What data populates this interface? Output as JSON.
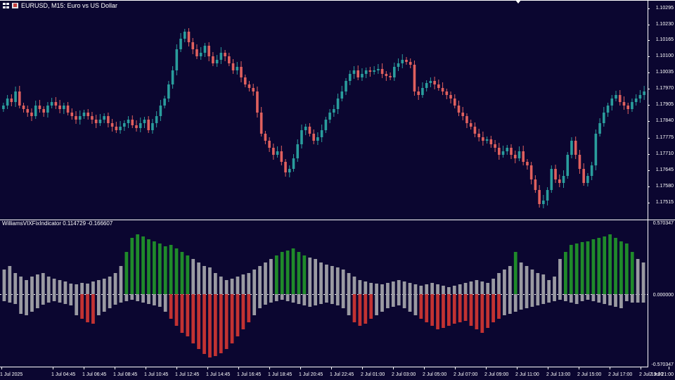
{
  "window": {
    "symbol_title": "EURUSD, M15:  Euro vs US Dollar",
    "icons": [
      "grid-icon",
      "chart-icon",
      "scroll-marker-icon"
    ]
  },
  "indicator": {
    "header": "WilliamsVIXFixIndicator 0.114729 -0.166607",
    "scale_labels": [
      "0.570347",
      "0.000000",
      "-0.570347"
    ]
  },
  "price_axis": {
    "labels": [
      "1.10295",
      "1.10230",
      "1.10165",
      "1.10100",
      "1.10035",
      "1.17970",
      "1.17905",
      "1.17840",
      "1.17775",
      "1.17710",
      "1.17645",
      "1.17580",
      "1.17515"
    ]
  },
  "time_axis": {
    "labels": [
      "1 Jul 2025",
      "1 Jul 04:45",
      "1 Jul 06:45",
      "1 Jul 08:45",
      "1 Jul 10:45",
      "1 Jul 12:45",
      "1 Jul 14:45",
      "1 Jul 16:45",
      "1 Jul 18:45",
      "1 Jul 20:45",
      "1 Jul 22:45",
      "2 Jul 01:00",
      "2 Jul 03:00",
      "2 Jul 05:00",
      "2 Jul 07:00",
      "2 Jul 09:00",
      "2 Jul 11:00",
      "2 Jul 13:00",
      "2 Jul 15:00",
      "2 Jul 17:00",
      "2 Jul 19:00",
      "2 Jul 21:00"
    ]
  },
  "colors": {
    "background": "#0b0630",
    "bull_candle": "#2a9d9d",
    "bear_candle": "#e0605e",
    "hist_positive_strong": "#1f8a2a",
    "hist_negative_strong": "#c23232",
    "hist_neutral": "#9a9aa2",
    "grid_line": "#ffffff"
  }
}
